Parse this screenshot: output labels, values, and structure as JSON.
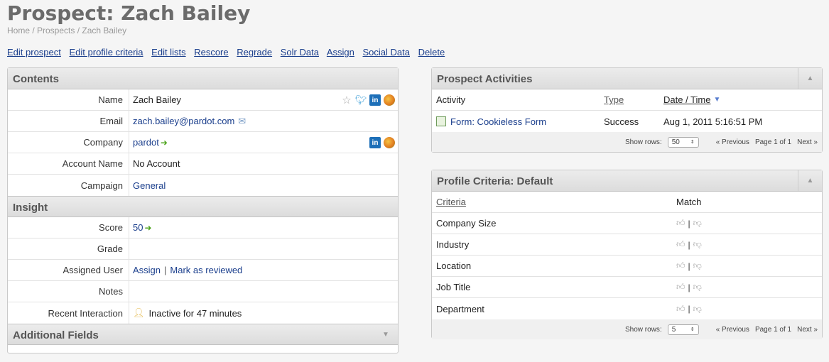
{
  "page": {
    "title": "Prospect: Zach Bailey",
    "breadcrumb": "Home / Prospects / Zach Bailey"
  },
  "actions": [
    "Edit prospect",
    "Edit profile criteria",
    "Edit lists",
    "Rescore",
    "Regrade",
    "Solr Data",
    "Assign",
    "Social Data",
    "Delete"
  ],
  "contents": {
    "title": "Contents",
    "name_label": "Name",
    "name_value": "Zach Bailey",
    "email_label": "Email",
    "email_value": "zach.bailey@pardot.com",
    "company_label": "Company",
    "company_value": "pardot",
    "account_label": "Account Name",
    "account_value": "No Account",
    "campaign_label": "Campaign",
    "campaign_value": "General"
  },
  "insight": {
    "title": "Insight",
    "score_label": "Score",
    "score_value": "50",
    "grade_label": "Grade",
    "grade_value": "",
    "assigned_label": "Assigned User",
    "assign_link": "Assign",
    "separator": "|",
    "review_link": "Mark as reviewed",
    "notes_label": "Notes",
    "interaction_label": "Recent Interaction",
    "interaction_value": "Inactive for 47 minutes"
  },
  "additional": {
    "title": "Additional Fields"
  },
  "activities": {
    "title": "Prospect Activities",
    "col_activity": "Activity",
    "col_type": "Type",
    "col_date": "Date / Time",
    "rows": [
      {
        "activity": "Form: Cookieless Form",
        "type": "Success",
        "date": "Aug 1, 2011 5:16:51 PM"
      }
    ],
    "footer": {
      "show_rows": "Show rows:",
      "rows_value": "50",
      "previous": "« Previous",
      "page": "Page 1 of 1",
      "next": "Next »"
    }
  },
  "criteria": {
    "title": "Profile Criteria: Default",
    "col_criteria": "Criteria",
    "col_match": "Match",
    "rows": [
      "Company Size",
      "Industry",
      "Location",
      "Job Title",
      "Department"
    ],
    "footer": {
      "show_rows": "Show rows:",
      "rows_value": "5",
      "previous": "« Previous",
      "page": "Page 1 of 1",
      "next": "Next »"
    }
  },
  "colors": {
    "link": "#1a3e8c",
    "title": "#6b6b6b",
    "header_bg": "#e3e3e3"
  }
}
